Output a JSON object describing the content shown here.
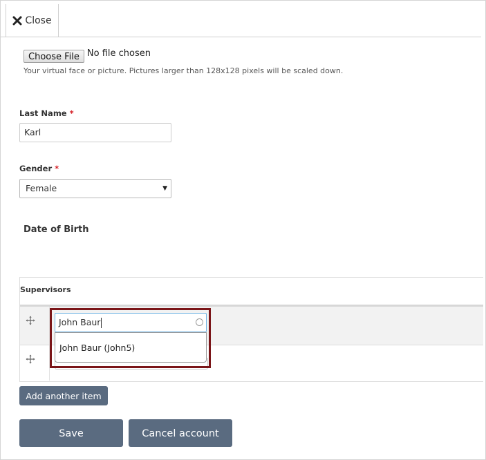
{
  "close": {
    "label": "Close",
    "icon": "close-x-icon"
  },
  "file": {
    "button_label": "Choose File",
    "status": "No file chosen",
    "help": "Your virtual face or picture. Pictures larger than 128x128 pixels will be scaled down."
  },
  "last_name": {
    "label": "Last Name",
    "required_mark": "*",
    "value": "Karl"
  },
  "gender": {
    "label": "Gender",
    "required_mark": "*",
    "selected": "Female",
    "caret": "▼"
  },
  "date_of_birth": {
    "title": "Date of Birth"
  },
  "supervisors": {
    "header": "Supervisors",
    "input_value": "John Baur",
    "suggestion": "John Baur (John5)",
    "add_label": "Add another item"
  },
  "actions": {
    "save_label": "Save",
    "cancel_label": "Cancel account"
  },
  "colors": {
    "highlight_border": "#7a1518",
    "button_bg": "#5a6b80",
    "required": "#d6232a",
    "focus_border": "#6eb3e3"
  }
}
